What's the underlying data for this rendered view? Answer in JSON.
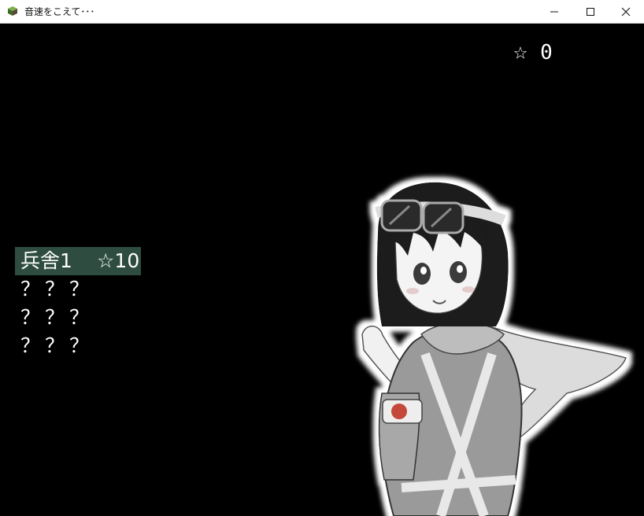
{
  "window": {
    "title": "音速をこえて･･･",
    "icon": "rpg-cube-icon"
  },
  "hud": {
    "star_icon": "☆",
    "star_count": "0"
  },
  "stage_menu": {
    "items": [
      {
        "name": "兵舎1",
        "cost": "☆10",
        "selected": true
      },
      {
        "label": "？？？"
      },
      {
        "label": "？？？"
      },
      {
        "label": "？？？"
      }
    ]
  },
  "colors": {
    "background": "#000000",
    "selected_item": "#2e4d40",
    "text": "#ffffff",
    "armband_dot": "#c44a3a"
  }
}
